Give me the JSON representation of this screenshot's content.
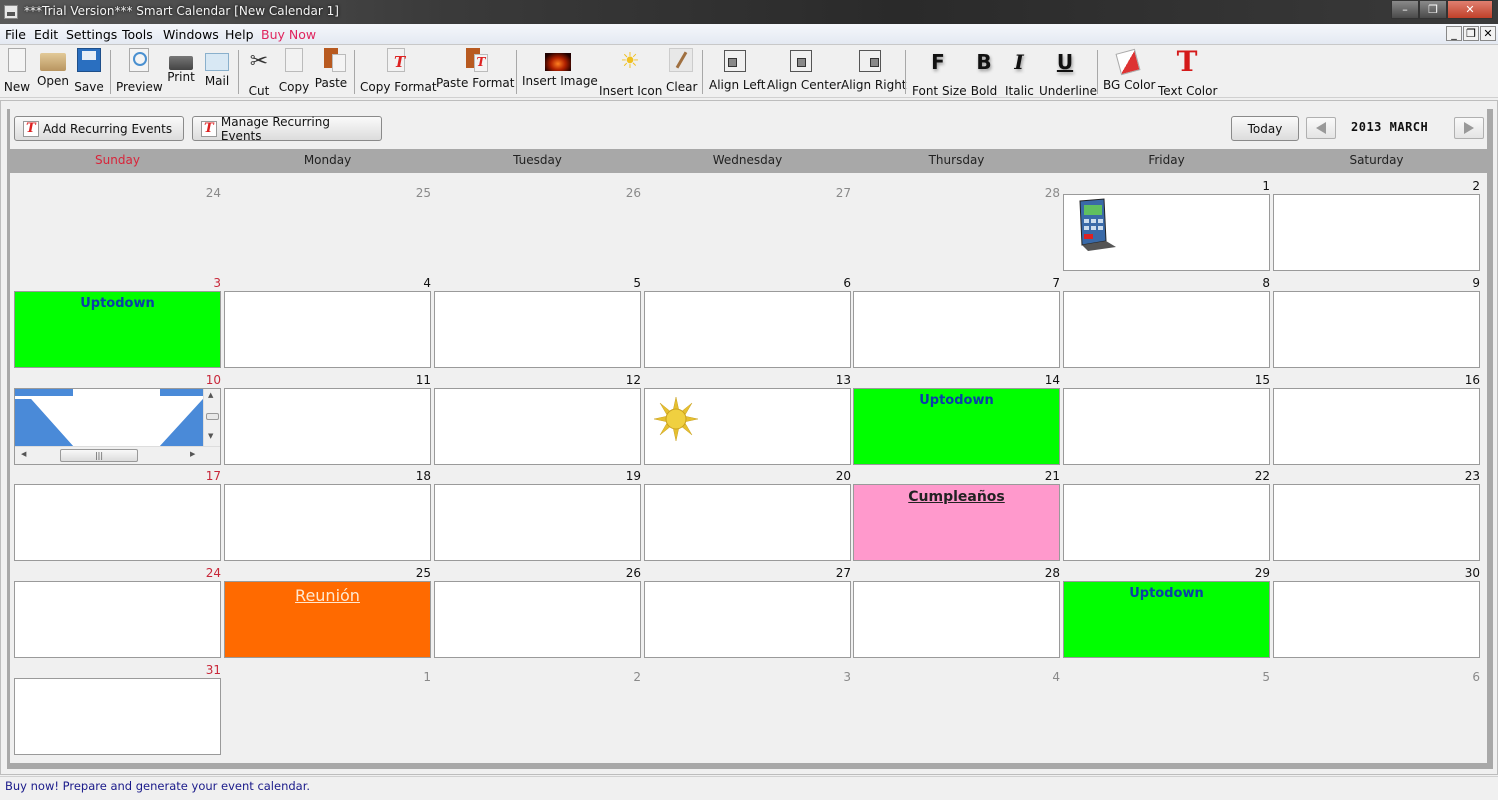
{
  "window": {
    "title": "***Trial Version*** Smart Calendar [New Calendar 1]",
    "controls": [
      "minimize",
      "restore",
      "close"
    ]
  },
  "menu": {
    "items": [
      "File",
      "Edit",
      "Settings",
      "Tools",
      "Windows",
      "Help"
    ],
    "buy_now": "Buy Now",
    "buy_now_color": "#e0245e"
  },
  "toolbar": {
    "buttons": [
      {
        "label": "New",
        "icon": "new-document-icon"
      },
      {
        "label": "Open",
        "icon": "open-folder-icon"
      },
      {
        "label": "Save",
        "icon": "save-floppy-icon"
      },
      {
        "label": "Preview",
        "icon": "preview-magnifier-icon"
      },
      {
        "label": "Print",
        "icon": "printer-icon"
      },
      {
        "label": "Mail",
        "icon": "mail-envelope-icon"
      },
      {
        "label": "Cut",
        "icon": "scissors-icon"
      },
      {
        "label": "Copy",
        "icon": "copy-icon"
      },
      {
        "label": "Paste",
        "icon": "paste-clipboard-icon"
      },
      {
        "label": "Copy Format",
        "icon": "copy-format-icon"
      },
      {
        "label": "Paste Format",
        "icon": "paste-format-icon"
      },
      {
        "label": "Insert Image",
        "icon": "image-icon"
      },
      {
        "label": "Insert Icon",
        "icon": "sun-icon"
      },
      {
        "label": "Clear",
        "icon": "brush-icon"
      },
      {
        "label": "Align Left",
        "icon": "align-left-icon"
      },
      {
        "label": "Align Center",
        "icon": "align-center-icon"
      },
      {
        "label": "Align Right",
        "icon": "align-right-icon"
      },
      {
        "label": "Font Size",
        "icon": "font-size-icon",
        "glyph": "F"
      },
      {
        "label": "Bold",
        "icon": "bold-icon",
        "glyph": "B"
      },
      {
        "label": "Italic",
        "icon": "italic-icon",
        "glyph": "I"
      },
      {
        "label": "Underline",
        "icon": "underline-icon",
        "glyph": "U"
      },
      {
        "label": "BG Color",
        "icon": "paint-bucket-icon"
      },
      {
        "label": "Text Color",
        "icon": "text-color-icon",
        "glyph": "T"
      }
    ]
  },
  "actions": {
    "add_recurring": "Add Recurring Events",
    "manage_recurring": "Manage Recurring Events",
    "today": "Today",
    "month_label": "2013 MARCH"
  },
  "calendar": {
    "weekdays": [
      "Sunday",
      "Monday",
      "Tuesday",
      "Wednesday",
      "Thursday",
      "Friday",
      "Saturday"
    ],
    "weeks": [
      [
        {
          "day": "24",
          "in_month": false
        },
        {
          "day": "25",
          "in_month": false
        },
        {
          "day": "26",
          "in_month": false
        },
        {
          "day": "27",
          "in_month": false
        },
        {
          "day": "28",
          "in_month": false
        },
        {
          "day": "1",
          "in_month": true,
          "image": "calculator-icon"
        },
        {
          "day": "2",
          "in_month": true
        }
      ],
      [
        {
          "day": "3",
          "in_month": true,
          "event": "Uptodown",
          "bg": "#00ff00",
          "style": "up"
        },
        {
          "day": "4",
          "in_month": true
        },
        {
          "day": "5",
          "in_month": true
        },
        {
          "day": "6",
          "in_month": true
        },
        {
          "day": "7",
          "in_month": true
        },
        {
          "day": "8",
          "in_month": true
        },
        {
          "day": "9",
          "in_month": true
        }
      ],
      [
        {
          "day": "10",
          "in_month": true,
          "image": "arrow-image-scrollable"
        },
        {
          "day": "11",
          "in_month": true
        },
        {
          "day": "12",
          "in_month": true
        },
        {
          "day": "13",
          "in_month": true,
          "image": "sun-icon"
        },
        {
          "day": "14",
          "in_month": true,
          "event": "Uptodown",
          "bg": "#00ff00",
          "style": "up"
        },
        {
          "day": "15",
          "in_month": true
        },
        {
          "day": "16",
          "in_month": true
        }
      ],
      [
        {
          "day": "17",
          "in_month": true
        },
        {
          "day": "18",
          "in_month": true
        },
        {
          "day": "19",
          "in_month": true
        },
        {
          "day": "20",
          "in_month": true
        },
        {
          "day": "21",
          "in_month": true,
          "event": "Cumpleaños",
          "bg": "#ff99cc",
          "style": "bday"
        },
        {
          "day": "22",
          "in_month": true
        },
        {
          "day": "23",
          "in_month": true
        }
      ],
      [
        {
          "day": "24",
          "in_month": true
        },
        {
          "day": "25",
          "in_month": true,
          "event": "Reunión",
          "bg": "#ff6a00",
          "style": "meet"
        },
        {
          "day": "26",
          "in_month": true
        },
        {
          "day": "27",
          "in_month": true
        },
        {
          "day": "28",
          "in_month": true
        },
        {
          "day": "29",
          "in_month": true,
          "event": "Uptodown",
          "bg": "#00ff00",
          "style": "up"
        },
        {
          "day": "30",
          "in_month": true
        }
      ],
      [
        {
          "day": "31",
          "in_month": true
        },
        {
          "day": "1",
          "in_month": false
        },
        {
          "day": "2",
          "in_month": false
        },
        {
          "day": "3",
          "in_month": false
        },
        {
          "day": "4",
          "in_month": false
        },
        {
          "day": "5",
          "in_month": false
        },
        {
          "day": "6",
          "in_month": false
        }
      ]
    ]
  },
  "status": {
    "message": "Buy now! Prepare and generate your event calendar."
  },
  "colors": {
    "sunday": "#c8283a",
    "header_bar": "#a8a8a8",
    "event_green": "#00ff00",
    "event_pink": "#ff99cc",
    "event_orange": "#ff6a00"
  }
}
